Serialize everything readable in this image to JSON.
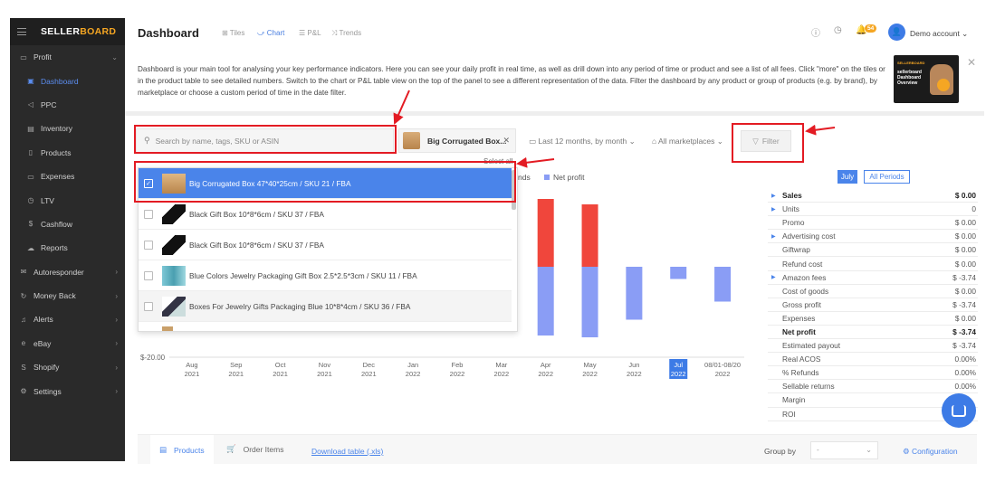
{
  "sidebar": {
    "brand_left": "SELLER",
    "brand_right": "BOARD",
    "items": [
      {
        "label": "Profit",
        "icon": "monitor-icon",
        "chevron": "⌄"
      },
      {
        "label": "Dashboard",
        "icon": "dashboard-icon"
      },
      {
        "label": "PPC",
        "icon": "megaphone-icon"
      },
      {
        "label": "Inventory",
        "icon": "inventory-icon"
      },
      {
        "label": "Products",
        "icon": "products-icon"
      },
      {
        "label": "Expenses",
        "icon": "expenses-icon"
      },
      {
        "label": "LTV",
        "icon": "clock-icon"
      },
      {
        "label": "Cashflow",
        "icon": "dollar-icon"
      },
      {
        "label": "Reports",
        "icon": "cloud-icon"
      },
      {
        "label": "Autoresponder",
        "icon": "mail-icon",
        "chevron": "›"
      },
      {
        "label": "Money Back",
        "icon": "refresh-icon",
        "chevron": "›"
      },
      {
        "label": "Alerts",
        "icon": "bell-icon",
        "chevron": "›"
      },
      {
        "label": "eBay",
        "icon": "ebay-icon",
        "chevron": "›"
      },
      {
        "label": "Shopify",
        "icon": "shopify-icon",
        "chevron": "›"
      },
      {
        "label": "Settings",
        "icon": "gear-icon",
        "chevron": "›"
      }
    ]
  },
  "header": {
    "title": "Dashboard",
    "tabs": [
      "Tiles",
      "Chart",
      "P&L",
      "Trends"
    ],
    "notifications": "54",
    "account": "Demo account"
  },
  "intro": {
    "text": "Dashboard is your main tool for analysing your key performance indicators. Here you can see your daily profit in real time, as well as drill down into any period of time or product and see a list of all fees. Click \"more\" on the tiles or in the product table to see detailed numbers. Switch to the chart or P&L table view on the top of the panel to see a different representation of the data. Filter the dashboard by any product or group of products (e.g. by brand), by marketplace or choose a custom period of time in the date filter.",
    "video_brand": "SELLERBOARD",
    "video_title": "sellerboard Dashboard Overview"
  },
  "filters": {
    "search_placeholder": "Search by name, tags, SKU or ASIN",
    "selected_product": "Big Corrugated Box...",
    "date": "Last 12 months, by month",
    "marketplace": "All marketplaces",
    "filter_label": "Filter",
    "select_all": "Select all"
  },
  "dropdown": {
    "items": [
      {
        "label": "Big Corrugated Box 47*40*25cm / SKU 21 / FBA",
        "selected": true
      },
      {
        "label": "Black Gift Box 10*8*6cm / SKU 37 / FBA",
        "selected": false
      },
      {
        "label": "Black Gift Box 10*8*6cm / SKU 37 / FBA",
        "selected": false
      },
      {
        "label": "Blue Colors Jewelry Packaging Gift Box 2.5*2.5*3cm / SKU 11 / FBA",
        "selected": false
      },
      {
        "label": "Boxes For Jewelry Gifts Packaging Blue 10*8*4cm / SKU 36 / FBA",
        "selected": false
      }
    ]
  },
  "legend": {
    "partial": "nds",
    "net_profit": "Net profit"
  },
  "chart_data": {
    "type": "bar",
    "categories": [
      [
        "Aug",
        "2021"
      ],
      [
        "Sep",
        "2021"
      ],
      [
        "Oct",
        "2021"
      ],
      [
        "Nov",
        "2021"
      ],
      [
        "Dec",
        "2021"
      ],
      [
        "Jan",
        "2022"
      ],
      [
        "Feb",
        "2022"
      ],
      [
        "Mar",
        "2022"
      ],
      [
        "Apr",
        "2022"
      ],
      [
        "May",
        "2022"
      ],
      [
        "Jun",
        "2022"
      ],
      [
        "Jul",
        "2022"
      ],
      [
        "08/01-08/20",
        "2022"
      ]
    ],
    "highlight_index": 11,
    "y_min_label": "$-20.00",
    "ylim": [
      -20,
      16
    ],
    "series": [
      {
        "color": "#f0463c",
        "values": [
          null,
          null,
          null,
          null,
          null,
          null,
          null,
          null,
          15.0,
          13.8,
          null,
          null,
          null
        ]
      },
      {
        "name": "Net profit",
        "color": "#8a9df5",
        "values": [
          null,
          null,
          null,
          null,
          null,
          null,
          null,
          null,
          -15.2,
          -15.6,
          -11.7,
          -2.7,
          -7.7
        ]
      }
    ]
  },
  "periods": {
    "july": "July",
    "all": "All Periods"
  },
  "metrics": [
    {
      "label": "Sales",
      "value": "$ 0.00",
      "bold": true,
      "expand": true
    },
    {
      "label": "Units",
      "value": "0",
      "expand": true
    },
    {
      "label": "Promo",
      "value": "$ 0.00"
    },
    {
      "label": "Advertising cost",
      "value": "$ 0.00",
      "expand": true
    },
    {
      "label": "Giftwrap",
      "value": "$ 0.00"
    },
    {
      "label": "Refund cost",
      "value": "$ 0.00"
    },
    {
      "label": "Amazon fees",
      "value": "$ -3.74",
      "expand": true
    },
    {
      "label": "Cost of goods",
      "value": "$ 0.00"
    },
    {
      "label": "Gross profit",
      "value": "$ -3.74"
    },
    {
      "label": "Expenses",
      "value": "$ 0.00"
    },
    {
      "label": "Net profit",
      "value": "$ -3.74",
      "bold": true
    },
    {
      "label": "Estimated payout",
      "value": "$ -3.74"
    },
    {
      "label": "Real ACOS",
      "value": "0.00%"
    },
    {
      "label": "% Refunds",
      "value": "0.00%"
    },
    {
      "label": "Sellable returns",
      "value": "0.00%"
    },
    {
      "label": "Margin",
      "value": ""
    },
    {
      "label": "ROI",
      "value": ""
    }
  ],
  "bottom": {
    "tab_products": "Products",
    "tab_order_items": "Order Items",
    "download": "Download table (.xls)",
    "group_by": "Group by",
    "group_by_value": "-",
    "configuration": "Configuration"
  },
  "colors": {
    "accent": "#4a84ea",
    "annotation": "#e31b23",
    "sidebar_bg": "#2a2a2a"
  }
}
